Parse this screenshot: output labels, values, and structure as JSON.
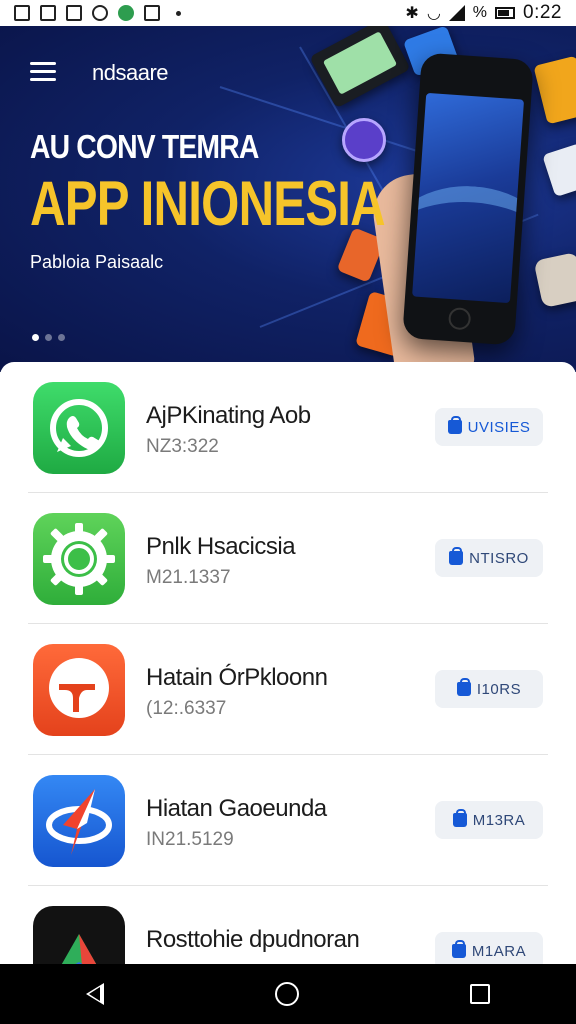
{
  "status_bar": {
    "battery_percent": "%",
    "clock": "0:22"
  },
  "header": {
    "brand": "ndsaare"
  },
  "hero": {
    "subtitle": "AU CONV TEMRA",
    "title": "APP INIONESIA",
    "tagline": "Pabloia Paisaalc",
    "slide_count": 3,
    "active_slide": 1,
    "colors": {
      "title": "#f6c42a",
      "background": "#0f2266"
    }
  },
  "apps": [
    {
      "name": "AjPKinating Aob",
      "meta": "NZ3:322",
      "button": "UVISIES",
      "icon": "whatsapp-icon",
      "color": "#2fc85a"
    },
    {
      "name": "Pnlk Hsacicsia",
      "meta": "M21.1337",
      "button": "NTISRO",
      "icon": "gear-icon",
      "color": "#44c24a"
    },
    {
      "name": "Hatain ÓrPkloonn",
      "meta": "(12:.6337",
      "button": "I10RS",
      "icon": "speech-bubble-icon",
      "color": "#f2502a"
    },
    {
      "name": "Hiatan Gaoeunda",
      "meta": "IN21.5129",
      "button": "M13RA",
      "icon": "arrow-ring-icon",
      "color": "#1f6fe6"
    },
    {
      "name": "Rosttohie dpudnoran",
      "meta": "",
      "button": "M1ARA",
      "icon": "triangle-logo-icon",
      "color": "#111111"
    }
  ]
}
